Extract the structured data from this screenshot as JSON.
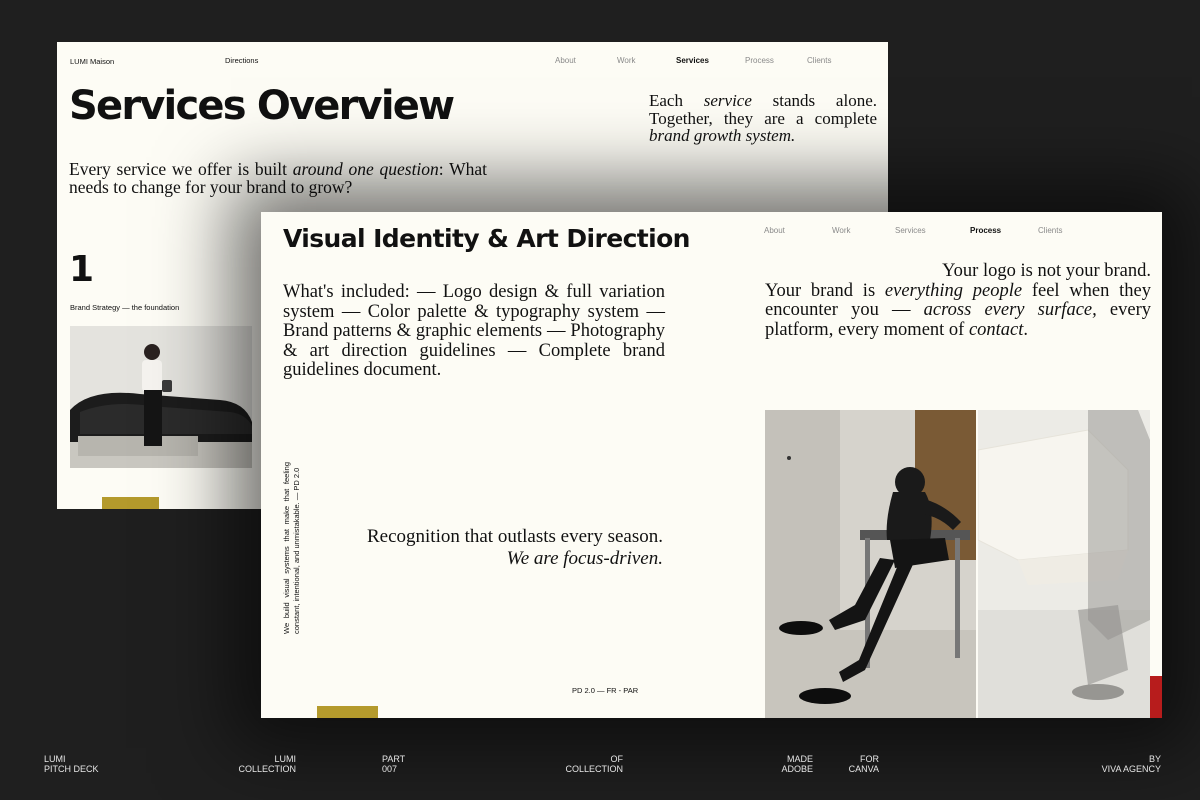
{
  "back_slide": {
    "brand": "LUMI Maison",
    "directions": "Directions",
    "nav": [
      "About",
      "Work",
      "Services",
      "Process",
      "Clients"
    ],
    "active_nav": "Services",
    "title": "Services Overview",
    "tagline": {
      "p1": "Each ",
      "p1_em": "service",
      "p2": " stands alone. Together, they are a complete ",
      "p2_em": "brand growth system."
    },
    "question": {
      "p1": "Every service we offer is built ",
      "p1_em": "around one question",
      "p2": ": What needs to change for your brand to grow?"
    },
    "number": "1",
    "number_label": "Brand Strategy — the foundation"
  },
  "front_slide": {
    "title": "Visual Identity & Art Direction",
    "nav": [
      "About",
      "Work",
      "Services",
      "Process",
      "Clients"
    ],
    "active_nav": "Process",
    "included": "What's included: — Logo design & full variation system — Color palette & typography system — Brand patterns & graphic elements — Photography & art direction guidelines — Complete brand guidelines document.",
    "logo_quote": {
      "l1": "Your logo is not your brand.",
      "p1": "Your brand is ",
      "p1_em": "everything people",
      "p2": " feel when they encounter you — ",
      "p2_em": "across every surface,",
      "p3": " every platform, every moment of ",
      "p3_em": "contact",
      "p4": "."
    },
    "vertical_text": "We build visual systems that make that feeling constant, intentional, and unmistakable. — PD 2.0",
    "recognition_line1": "Recognition that outlasts every season.",
    "recognition_line2": "We are focus-driven.",
    "footer_code": "PD 2.0 — FR - PAR"
  },
  "footer": {
    "c1": [
      "LUMI",
      "PITCH DECK"
    ],
    "c2": [
      "LUMI",
      "COLLECTION"
    ],
    "c3": [
      "PART",
      "007"
    ],
    "c4": [
      "OF",
      "COLLECTION"
    ],
    "c5": [
      "MADE",
      "ADOBE"
    ],
    "c6": [
      "FOR",
      "CANVA"
    ],
    "c7": [
      "BY",
      "VIVA AGENCY"
    ]
  },
  "colors": {
    "background": "#1f1f1f",
    "paper": "#fdfcf5",
    "accent_mustard": "#b49a2c",
    "accent_red": "#b71c1c"
  }
}
